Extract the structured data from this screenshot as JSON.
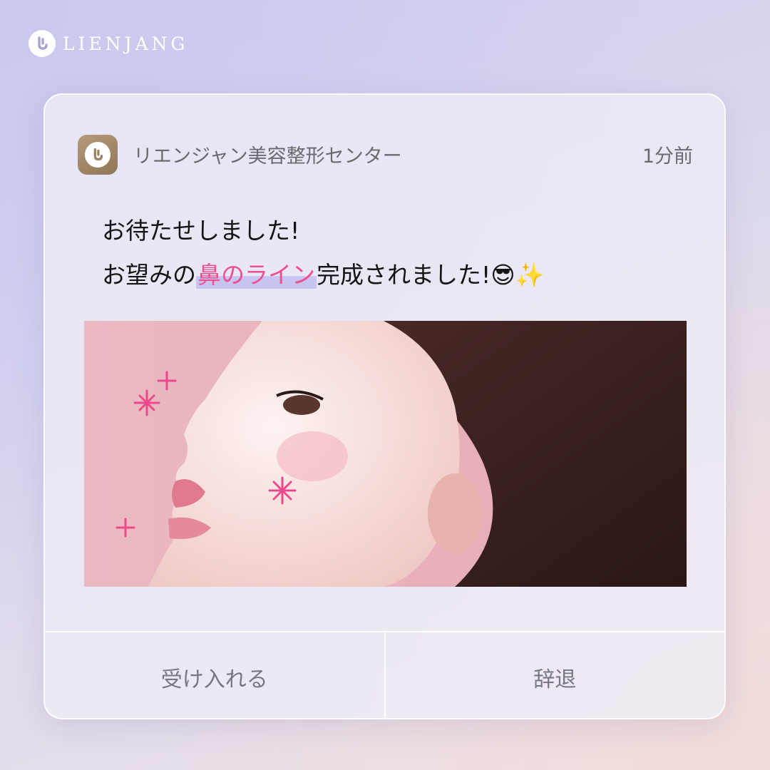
{
  "brand": {
    "name": "LIENJANG",
    "icon": "lienjang-logo-icon"
  },
  "notification": {
    "app_name": "リエンジャン美容整形センター",
    "app_icon": "lienjang-app-icon",
    "time": "1分前",
    "line1": "お待たせしました!",
    "line2_before": "お望みの",
    "line2_highlight": "鼻のライン",
    "line2_after": "完成されました!",
    "emoji": "😎✨",
    "image": "woman-profile-photo"
  },
  "actions": {
    "accept": "受け入れる",
    "decline": "辞退"
  },
  "colors": {
    "highlight_text": "#ee4f8e",
    "highlight_bg": "#c4c0f0",
    "app_icon_bg": "#a08867"
  }
}
